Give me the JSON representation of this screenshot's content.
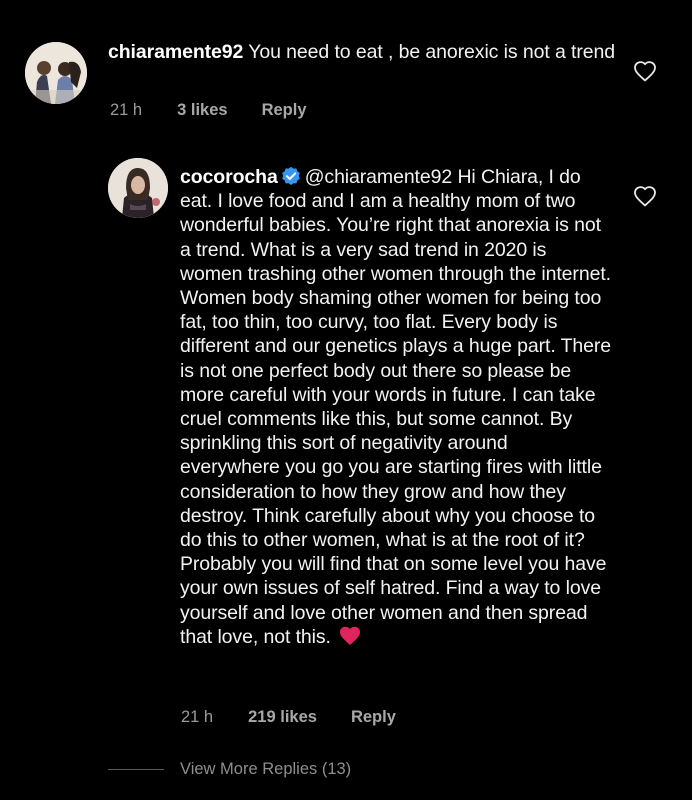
{
  "comment1": {
    "username": "chiaramente92",
    "text": "You need to eat , be anorexic is not a trend",
    "time": "21 h",
    "likes": "3 likes",
    "reply": "Reply",
    "like_icon": "heart-outline-icon"
  },
  "comment2": {
    "username": "cocorocha",
    "verified_icon": "verified-badge-icon",
    "mention": "@chiaramente92",
    "text": "Hi Chiara, I do eat. I love food and I am a healthy mom of two wonderful babies. You’re right that anorexia is not a trend. What is a very sad trend in 2020 is women trashing other women through the internet. Women body shaming other women for being too fat, too thin, too curvy, too flat. Every body is different and our genetics plays a huge part. There is not one perfect body out there so please be  more careful with your words in future. I can take cruel comments like this, but some cannot. By sprinkling this sort of negativity around everywhere you go you are starting fires with little consideration to how they grow and how they destroy. Think carefully about why you choose to do this to other women, what is at the root of it? Probably you will find that on some level you have your own issues of self hatred. Find a way to love yourself and love other women and then spread that love, not this.",
    "emoji": "red-heart-emoji",
    "time": "21 h",
    "likes": "219 likes",
    "reply": "Reply",
    "like_icon": "heart-outline-icon"
  },
  "view_more": {
    "label": "View More Replies (13)"
  },
  "colors": {
    "background": "#000000",
    "text": "#f2f2f2",
    "meta": "#9a9a9a",
    "verified": "#3797f0",
    "emoji_heart": "#e0245e"
  }
}
